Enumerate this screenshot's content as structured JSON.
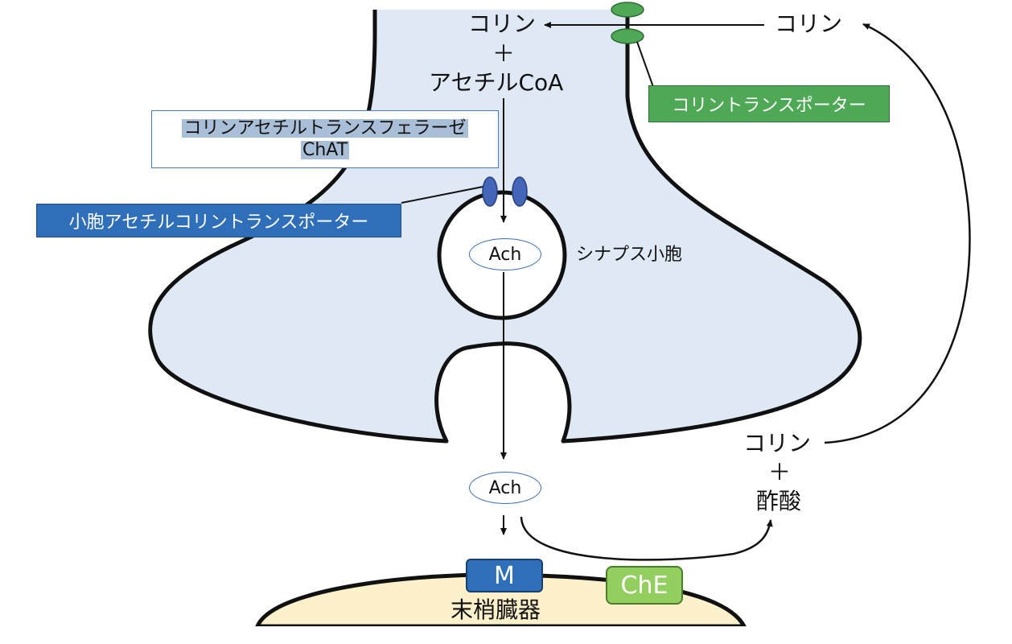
{
  "labels": {
    "choline_inside": "コリン",
    "plus_inside": "＋",
    "acetyl_coa": "アセチルCoA",
    "choline_outside": "コリン",
    "chat_line1": "コリンアセチルトランスフェラーゼ",
    "chat_line2": "ChAT",
    "choline_transporter": "コリントランスポーター",
    "vesicular_transporter": "小胞アセチルコリントランスポーター",
    "ach_vesicle": "Ach",
    "synaptic_vesicle": "シナプス小胞",
    "ach_cleft": "Ach",
    "choline_product": "コリン",
    "plus_product": "＋",
    "acetic_acid": "酢酸",
    "receptor_m": "M",
    "enzyme_che": "ChE",
    "peripheral_organ": "末梢臓器"
  },
  "colors": {
    "terminal_fill": "#dfe9f5",
    "organ_fill": "#fdf1cc",
    "transporter_green": "#4ea855",
    "transporter_blue": "#4466b8",
    "receptor_blue": "#2f6fba",
    "enzyme_green": "#93cf5f"
  }
}
